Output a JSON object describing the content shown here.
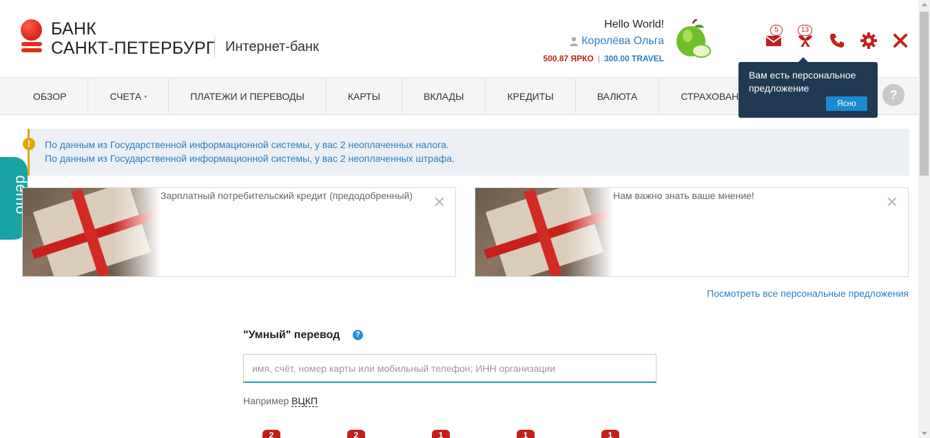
{
  "header": {
    "logo_line1": "БАНК",
    "logo_line2": "САНКТ-ПЕТЕРБУРГ",
    "subtitle": "Интернет-банк",
    "greeting": "Hello World!",
    "user_name": "Королёва Ольга",
    "balance_yarko": "500.87 ЯРКО",
    "balance_sep": "|",
    "balance_travel": "300.00 TRAVEL",
    "icons": [
      {
        "name": "mail-icon",
        "badge": "5"
      },
      {
        "name": "offers-icon",
        "badge": "13"
      },
      {
        "name": "phone-icon",
        "badge": ""
      },
      {
        "name": "gear-icon",
        "badge": ""
      },
      {
        "name": "close-icon",
        "badge": ""
      }
    ],
    "accent_color": "#c0221b"
  },
  "nav": {
    "items": [
      "ОБЗОР",
      "СЧЕТА",
      "ПЛАТЕЖИ И ПЕРЕВОДЫ",
      "КАРТЫ",
      "ВКЛАДЫ",
      "КРЕДИТЫ",
      "ВАЛЮТА",
      "СТРАХОВАНИЕ"
    ],
    "accounts_caret": "▾",
    "help": "?"
  },
  "tooltip": {
    "text": "Вам есть персональное предложение",
    "button": "Ясно"
  },
  "alert": {
    "icon": "!",
    "line1": "По данным из Государственной информационной системы, у вас 2 неоплаченных налога.",
    "line2": "По данным из Государственной информационной системы, у вас 2 неоплаченных штрафа."
  },
  "demo_tab": "demo",
  "offers": [
    {
      "title": "Зарплатный потребительский кредит (предодобренный)",
      "close": "✕"
    },
    {
      "title": "Нам важно знать ваше мнение!",
      "close": "✕"
    }
  ],
  "all_offers_link": "Посмотреть все персональные предложения",
  "smart_transfer": {
    "title": "\"Умный\" перевод",
    "help": "?",
    "placeholder": "имя, счёт, номер карты или мобильный телефон; ИНН организации",
    "example_label": "Например",
    "example_value": "ВЦКП"
  },
  "counters": [
    "2",
    "2",
    "1",
    "1",
    "1"
  ]
}
